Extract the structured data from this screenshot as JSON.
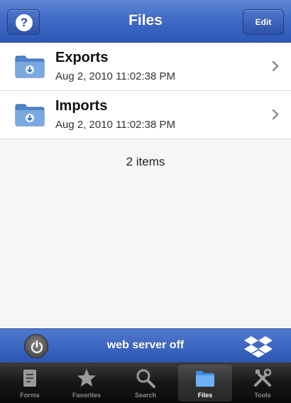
{
  "navbar": {
    "title": "Files",
    "help_label": "?",
    "edit_label": "Edit"
  },
  "list": {
    "items": [
      {
        "name": "Exports",
        "date": "Aug 2, 2010 11:02:38 PM",
        "icon": "folder-icon"
      },
      {
        "name": "Imports",
        "date": "Aug 2, 2010 11:02:38 PM",
        "icon": "folder-icon"
      }
    ],
    "count_label": "2 items"
  },
  "server_bar": {
    "status": "web server off",
    "power_icon": "power-icon",
    "dropbox_icon": "dropbox-icon"
  },
  "tabbar": {
    "tabs": [
      {
        "label": "Forms",
        "icon": "forms-icon",
        "active": false
      },
      {
        "label": "Favorites",
        "icon": "star-icon",
        "active": false
      },
      {
        "label": "Search",
        "icon": "search-icon",
        "active": false
      },
      {
        "label": "Files",
        "icon": "folder-icon",
        "active": true
      },
      {
        "label": "Tools",
        "icon": "tools-icon",
        "active": false
      }
    ]
  },
  "colors": {
    "nav_blue": "#3e69c6",
    "tab_bar": "#161616",
    "folder_blue": "#5b90d3"
  }
}
